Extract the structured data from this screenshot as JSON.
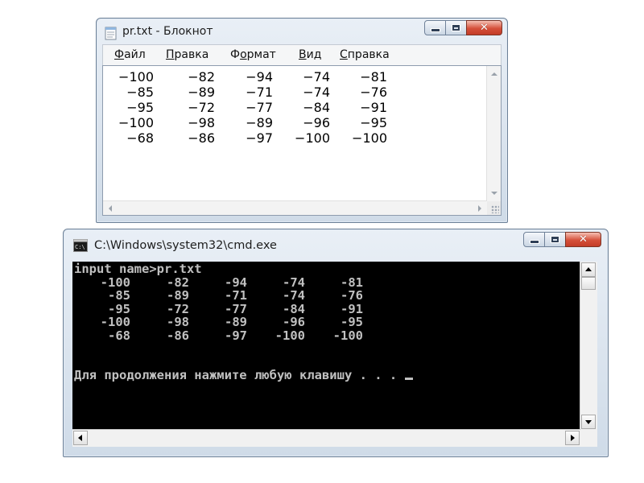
{
  "notepad": {
    "title": "pr.txt - Блокнот",
    "menu": [
      {
        "first": "Ф",
        "rest": "айл"
      },
      {
        "first": "П",
        "rest": "равка"
      },
      {
        "first": "Фо",
        "rest": "рмат",
        "ul_index": 1
      },
      {
        "first": "В",
        "rest": "ид"
      },
      {
        "first": "С",
        "rest": "правка"
      }
    ],
    "rows": [
      [
        "−100",
        "−82",
        "−94",
        "−74",
        "−81"
      ],
      [
        "−85",
        "−89",
        "−71",
        "−74",
        "−76"
      ],
      [
        "−95",
        "−72",
        "−77",
        "−84",
        "−91"
      ],
      [
        "−100",
        "−98",
        "−89",
        "−96",
        "−95"
      ],
      [
        "−68",
        "−86",
        "−97",
        "−100",
        "−100"
      ]
    ]
  },
  "cmd": {
    "title": "C:\\Windows\\system32\\cmd.exe",
    "icon_label": "C:\\",
    "prompt_line": "input name>pr.txt",
    "rows": [
      [
        "-100",
        "-82",
        "-94",
        "-74",
        "-81"
      ],
      [
        "-85",
        "-89",
        "-71",
        "-74",
        "-76"
      ],
      [
        "-95",
        "-72",
        "-77",
        "-84",
        "-91"
      ],
      [
        "-100",
        "-98",
        "-89",
        "-96",
        "-95"
      ],
      [
        "-68",
        "-86",
        "-97",
        "-100",
        "-100"
      ]
    ],
    "continue_line": "Для продолжения нажмите любую клавишу . . . "
  }
}
